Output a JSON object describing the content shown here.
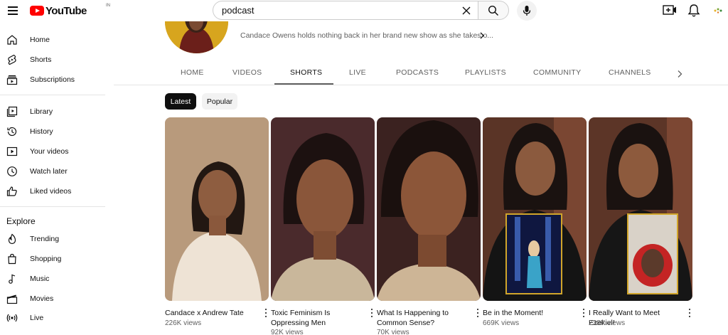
{
  "header": {
    "logo_text": "YouTube",
    "country_code": "IN",
    "search_value": "podcast",
    "search_placeholder": "Search"
  },
  "sidebar": {
    "main": [
      {
        "label": "Home",
        "icon": "home-icon"
      },
      {
        "label": "Shorts",
        "icon": "shorts-icon"
      },
      {
        "label": "Subscriptions",
        "icon": "subscriptions-icon"
      }
    ],
    "library": [
      {
        "label": "Library",
        "icon": "library-icon"
      },
      {
        "label": "History",
        "icon": "history-icon"
      },
      {
        "label": "Your videos",
        "icon": "your-videos-icon"
      },
      {
        "label": "Watch later",
        "icon": "watch-later-icon"
      },
      {
        "label": "Liked videos",
        "icon": "liked-videos-icon"
      }
    ],
    "explore_heading": "Explore",
    "explore": [
      {
        "label": "Trending",
        "icon": "trending-icon"
      },
      {
        "label": "Shopping",
        "icon": "shopping-icon"
      },
      {
        "label": "Music",
        "icon": "music-icon"
      },
      {
        "label": "Movies",
        "icon": "movies-icon"
      },
      {
        "label": "Live",
        "icon": "live-icon"
      }
    ]
  },
  "channel": {
    "description": "Candace Owens holds nothing back in her brand new show as she takes o..."
  },
  "tabs": [
    "HOME",
    "VIDEOS",
    "SHORTS",
    "LIVE",
    "PODCASTS",
    "PLAYLISTS",
    "COMMUNITY",
    "CHANNELS"
  ],
  "active_tab": "SHORTS",
  "chips": [
    "Latest",
    "Popular"
  ],
  "active_chip": "Latest",
  "shorts": [
    {
      "title": "Candace x Andrew Tate",
      "views": "226K views"
    },
    {
      "title": "Toxic Feminism Is Oppressing Men",
      "views": "92K views"
    },
    {
      "title": "What Is Happening to Common Sense?",
      "views": "70K views"
    },
    {
      "title": "Be in the Moment!",
      "views": "669K views"
    },
    {
      "title": "I Really Want to Meet Ezekiel!",
      "views": "238K views"
    }
  ],
  "colors": {
    "brand_red": "#ff0000",
    "text_primary": "#0f0f0f",
    "text_secondary": "#606060",
    "chip_selected": "#0f0f0f",
    "chip_unselected": "#f2f2f2"
  }
}
